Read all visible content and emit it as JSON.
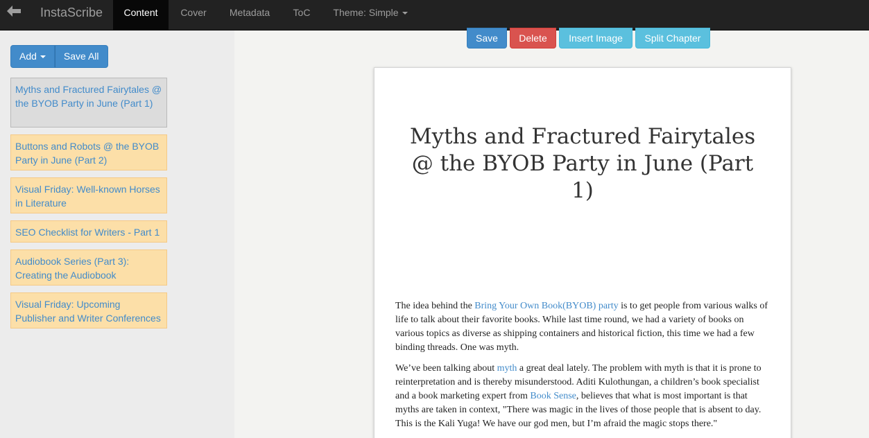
{
  "navbar": {
    "back_icon": "arrow-left-icon",
    "brand": "InstaScribe",
    "tabs": [
      {
        "label": "Content",
        "active": true
      },
      {
        "label": "Cover",
        "active": false
      },
      {
        "label": "Metadata",
        "active": false
      },
      {
        "label": "ToC",
        "active": false
      },
      {
        "label": "Theme: Simple",
        "active": false,
        "dropdown": true
      }
    ]
  },
  "sidebar": {
    "add_label": "Add",
    "save_all_label": "Save All",
    "chapters": [
      {
        "title": "Myths and Fractured Fairytales @ the BYOB Party in June (Part 1)",
        "selected": true
      },
      {
        "title": "Buttons and Robots @ the BYOB Party in June (Part 2)",
        "selected": false
      },
      {
        "title": "Visual Friday: Well-known Horses in Literature",
        "selected": false
      },
      {
        "title": "SEO Checklist for Writers - Part 1",
        "selected": false
      },
      {
        "title": "Audiobook Series (Part 3): Creating the Audiobook",
        "selected": false
      },
      {
        "title": "Visual Friday: Upcoming Publisher and Writer Conferences",
        "selected": false
      }
    ]
  },
  "toolbar": {
    "save_label": "Save",
    "delete_label": "Delete",
    "insert_image_label": "Insert Image",
    "split_chapter_label": "Split Chapter"
  },
  "document": {
    "title": "Myths and Fractured Fairytales @ the BYOB Party in June (Part 1)",
    "p1_a": "The idea behind the ",
    "p1_link": "Bring Your Own Book(BYOB) party",
    "p1_b": " is to get people from various walks of life to talk about their favorite books. While last time round, we had a variety of books on various topics as diverse as shipping containers and historical fiction, this time we had a few binding threads. One was myth.",
    "p2_a": "We’ve been talking about ",
    "p2_link1": "myth",
    "p2_b": " a great deal lately. The problem with myth is that it is prone to reinterpretation and is thereby  misunderstood. Aditi  Kulothungan, a children’s book specialist and a book marketing expert from ",
    "p2_link2": "Book Sense",
    "p2_c": ", believes that what is most important is that myths are taken in context, \"There was magic in the lives of those people that is absent to day. This is the Kali Yuga! We have our god men, but I’m afraid the magic stops there.\""
  },
  "colors": {
    "navbar_bg": "#222222",
    "primary": "#428bca",
    "danger": "#d9534f",
    "info": "#5bc0de",
    "chapter_bg": "#fcdfa8"
  }
}
